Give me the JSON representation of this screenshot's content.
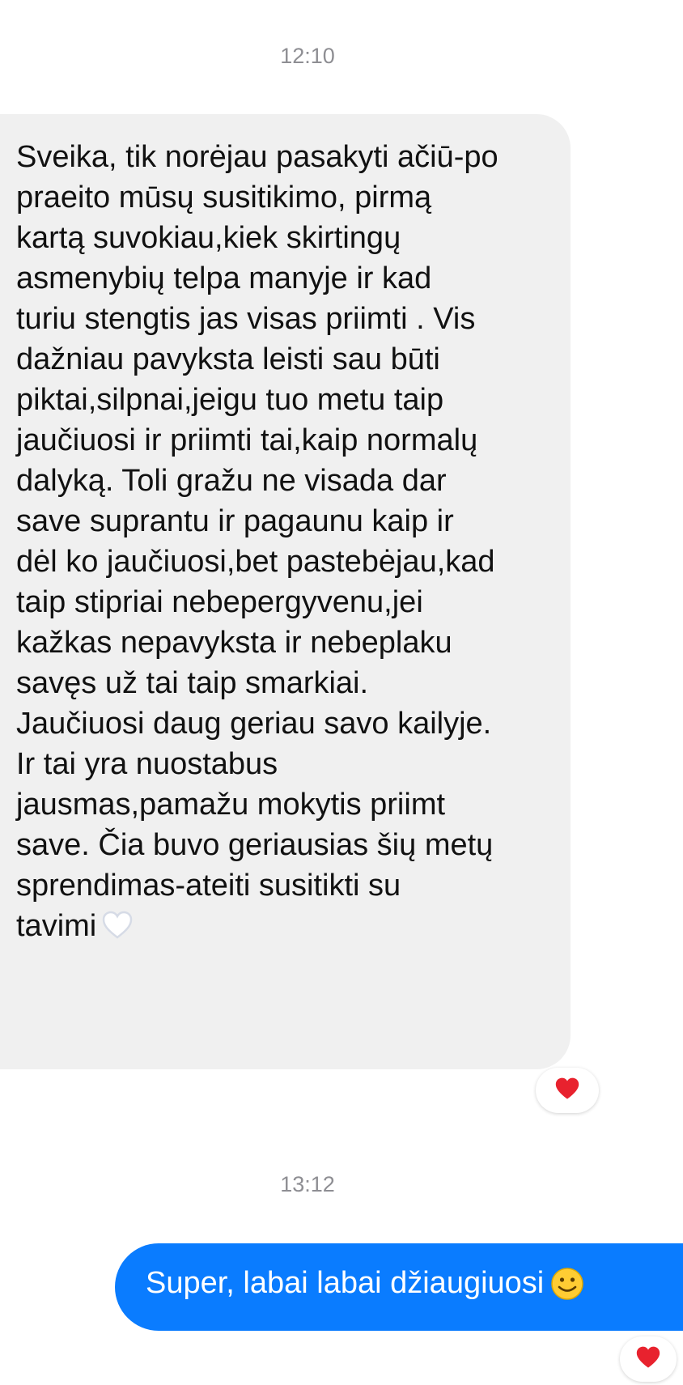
{
  "thread": {
    "timestamp_1": "12:10",
    "timestamp_2": "13:12"
  },
  "incoming_message": {
    "lines": [
      "Sveika, tik norėjau pasakyti ačiū-po",
      "praeito mūsų susitikimo, pirmą",
      "kartą suvokiau,kiek skirtingų",
      "asmenybių telpa manyje ir kad",
      "turiu stengtis jas visas priimti . Vis",
      "dažniau pavyksta leisti sau būti",
      "piktai,silpnai,jeigu tuo metu taip",
      "jaučiuosi ir priimti tai,kaip normalų",
      "dalyką. Toli gražu ne visada dar",
      "save suprantu ir pagaunu kaip ir",
      "dėl ko jaučiuosi,bet pastebėjau,kad",
      "taip stipriai nebepergyvenu,jei",
      "kažkas nepavyksta ir nebeplaku",
      "savęs už tai taip smarkiai.",
      "Jaučiuosi daug geriau savo kailyje.",
      "Ir tai yra nuostabus",
      "jausmas,pamažu mokytis priimt",
      "save. Čia buvo geriausias šių metų",
      "sprendimas-ateiti susitikti su",
      "tavimi"
    ],
    "trailing_icon": "white-heart-icon",
    "reaction_icon": "red-heart-icon"
  },
  "outgoing_message": {
    "text": "Super, labai labai džiaugiuosi",
    "trailing_icon": "smiley-icon",
    "reaction_icon": "red-heart-icon"
  },
  "colors": {
    "incoming_bubble": "#f0f0f0",
    "outgoing_bubble": "#0a7cff",
    "reaction_heart": "#e8222e",
    "timestamp": "#8e8e93"
  }
}
